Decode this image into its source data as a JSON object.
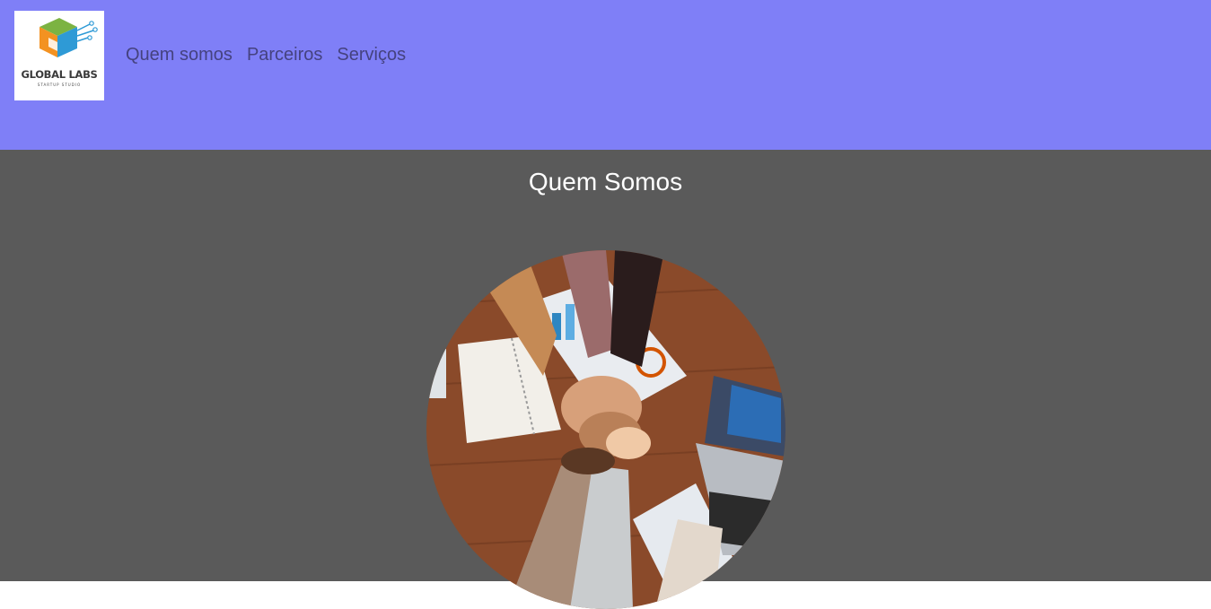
{
  "header": {
    "logo": {
      "title": "GLOBAL LABS",
      "subtitle": "STARTUP STUDIO"
    },
    "nav": [
      {
        "label": "Quem somos"
      },
      {
        "label": "Parceiros"
      },
      {
        "label": "Serviços"
      }
    ],
    "background_color": "#7f7ff7"
  },
  "main": {
    "title": "Quem Somos",
    "image_icon": "team-hands-together-photo",
    "background_color": "#5a5a5a"
  }
}
